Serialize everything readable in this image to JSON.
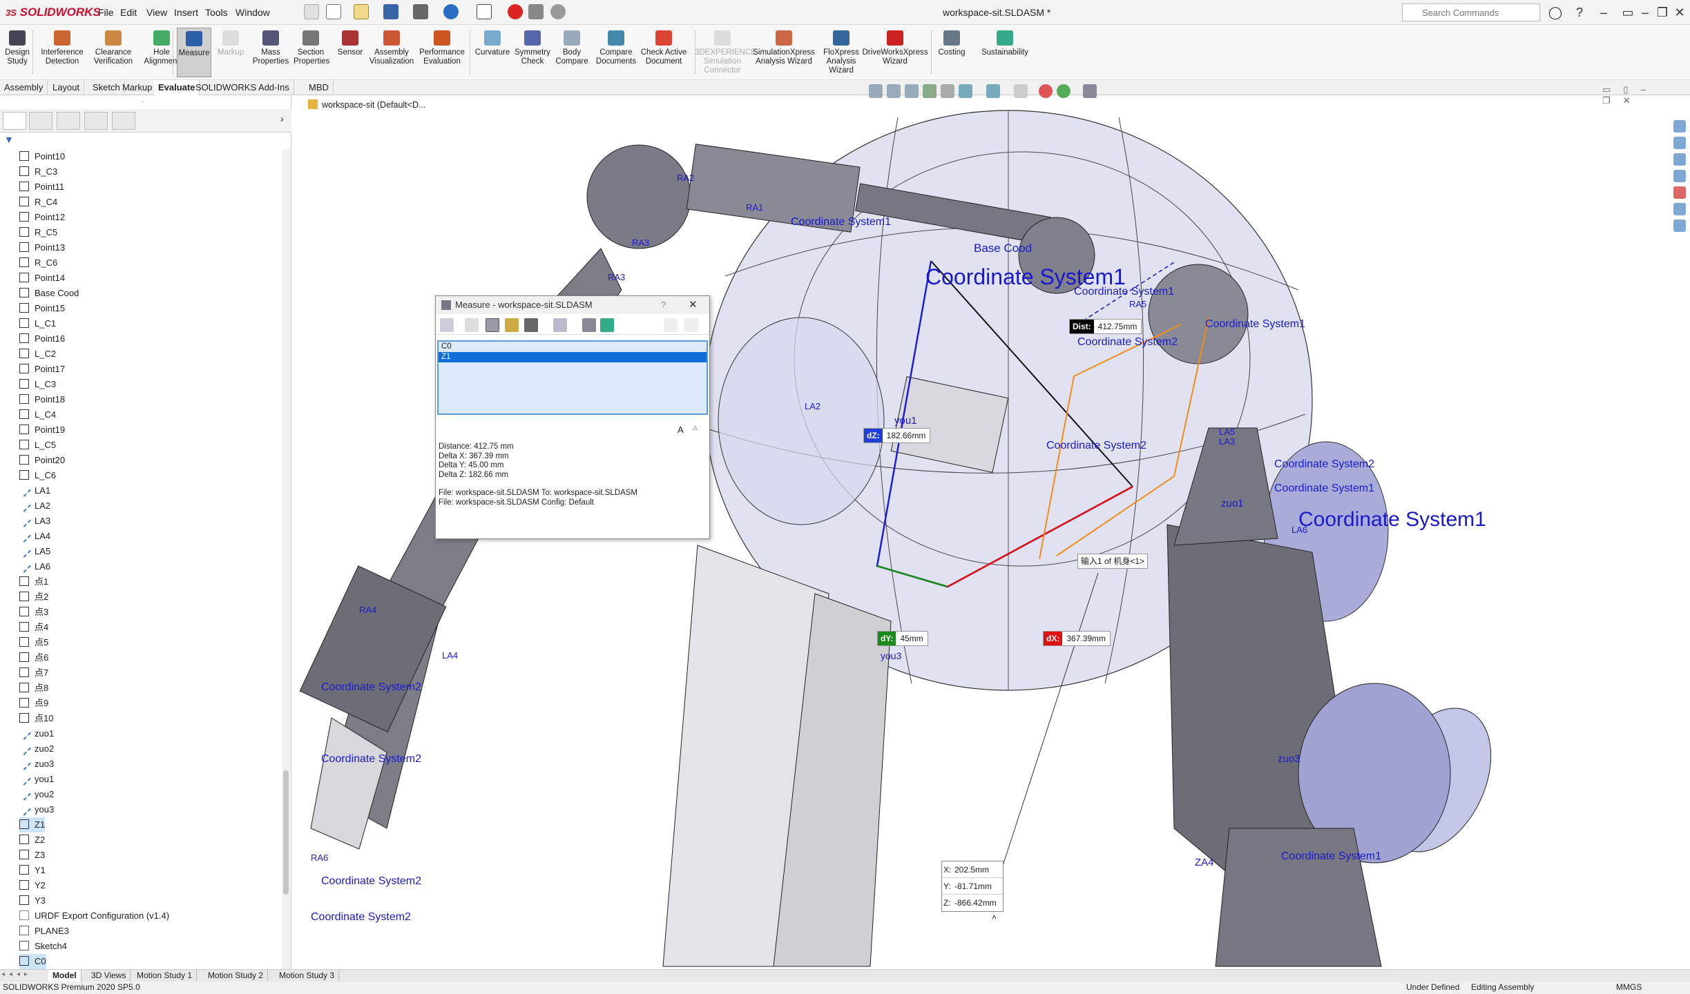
{
  "app": {
    "logo_brand": "SOLIDWORKS",
    "logo_prefix": "3S",
    "doc_title": "workspace-sit.SLDASM *",
    "search_placeholder": "Search Commands"
  },
  "menu": [
    "File",
    "Edit",
    "View",
    "Insert",
    "Tools",
    "Window"
  ],
  "ribbon": [
    {
      "label": "Design\nStudy"
    },
    {
      "label": "Interference\nDetection"
    },
    {
      "label": "Clearance\nVerification"
    },
    {
      "label": "Hole\nAlignment"
    },
    {
      "label": "Measure",
      "active": true
    },
    {
      "label": "Markup",
      "disabled": true
    },
    {
      "label": "Mass\nProperties"
    },
    {
      "label": "Section\nProperties"
    },
    {
      "label": "Sensor"
    },
    {
      "label": "Assembly\nVisualization"
    },
    {
      "label": "Performance\nEvaluation"
    },
    {
      "label": "Curvature"
    },
    {
      "label": "Symmetry\nCheck"
    },
    {
      "label": "Body\nCompare"
    },
    {
      "label": "Compare\nDocuments"
    },
    {
      "label": "Check Active\nDocument"
    },
    {
      "label": "3DEXPERIENCE\nSimulation\nConnector",
      "disabled": true
    },
    {
      "label": "SimulationXpress\nAnalysis Wizard"
    },
    {
      "label": "FloXpress\nAnalysis\nWizard"
    },
    {
      "label": "DriveWorksXpress\nWizard"
    },
    {
      "label": "Costing"
    },
    {
      "label": "Sustainability"
    }
  ],
  "command_tabs": [
    "Assembly",
    "Layout",
    "Sketch",
    "Markup",
    "Evaluate",
    "SOLIDWORKS Add-Ins",
    "MBD"
  ],
  "selected_command_tab": "Evaluate",
  "tree_items": [
    {
      "label": "Point10",
      "kind": "point"
    },
    {
      "label": "R_C3",
      "kind": "cs"
    },
    {
      "label": "Point11",
      "kind": "point"
    },
    {
      "label": "R_C4",
      "kind": "cs"
    },
    {
      "label": "Point12",
      "kind": "point"
    },
    {
      "label": "R_C5",
      "kind": "cs"
    },
    {
      "label": "Point13",
      "kind": "point"
    },
    {
      "label": "R_C6",
      "kind": "cs"
    },
    {
      "label": "Point14",
      "kind": "point"
    },
    {
      "label": "Base Cood",
      "kind": "cs"
    },
    {
      "label": "Point15",
      "kind": "point"
    },
    {
      "label": "L_C1",
      "kind": "cs"
    },
    {
      "label": "Point16",
      "kind": "point"
    },
    {
      "label": "L_C2",
      "kind": "cs"
    },
    {
      "label": "Point17",
      "kind": "point"
    },
    {
      "label": "L_C3",
      "kind": "cs"
    },
    {
      "label": "Point18",
      "kind": "point"
    },
    {
      "label": "L_C4",
      "kind": "cs"
    },
    {
      "label": "Point19",
      "kind": "point"
    },
    {
      "label": "L_C5",
      "kind": "cs"
    },
    {
      "label": "Point20",
      "kind": "point"
    },
    {
      "label": "L_C6",
      "kind": "cs"
    },
    {
      "label": "LA1",
      "kind": "axis"
    },
    {
      "label": "LA2",
      "kind": "axis"
    },
    {
      "label": "LA3",
      "kind": "axis"
    },
    {
      "label": "LA4",
      "kind": "axis"
    },
    {
      "label": "LA5",
      "kind": "axis"
    },
    {
      "label": "LA6",
      "kind": "axis"
    },
    {
      "label": "点1",
      "kind": "point"
    },
    {
      "label": "点2",
      "kind": "point"
    },
    {
      "label": "点3",
      "kind": "point"
    },
    {
      "label": "点4",
      "kind": "point"
    },
    {
      "label": "点5",
      "kind": "point"
    },
    {
      "label": "点6",
      "kind": "point"
    },
    {
      "label": "点7",
      "kind": "point"
    },
    {
      "label": "点8",
      "kind": "point"
    },
    {
      "label": "点9",
      "kind": "point"
    },
    {
      "label": "点10",
      "kind": "point"
    },
    {
      "label": "zuo1",
      "kind": "axis"
    },
    {
      "label": "zuo2",
      "kind": "axis"
    },
    {
      "label": "zuo3",
      "kind": "axis"
    },
    {
      "label": "you1",
      "kind": "axis"
    },
    {
      "label": "you2",
      "kind": "axis"
    },
    {
      "label": "you3",
      "kind": "axis"
    },
    {
      "label": "Z1",
      "kind": "cs",
      "selected": true
    },
    {
      "label": "Z2",
      "kind": "cs"
    },
    {
      "label": "Z3",
      "kind": "cs"
    },
    {
      "label": "Y1",
      "kind": "cs"
    },
    {
      "label": "Y2",
      "kind": "cs"
    },
    {
      "label": "Y3",
      "kind": "cs"
    },
    {
      "label": "URDF Export Configuration (v1.4)",
      "kind": "config"
    },
    {
      "label": "PLANE3",
      "kind": "plane"
    },
    {
      "label": "Sketch4",
      "kind": "sketch"
    },
    {
      "label": "C0",
      "kind": "cs",
      "selected": true
    }
  ],
  "breadcrumb": "workspace-sit  (Default<D...",
  "measure": {
    "title": "Measure - workspace-sit.SLDASM",
    "selections": [
      "C0",
      "Z1"
    ],
    "results": [
      "Distance: 412.75 mm",
      "Delta X: 367.39 mm",
      "Delta Y: 45.00 mm",
      "Delta Z: 182.66 mm",
      "",
      "File: workspace-sit.SLDASM To: workspace-sit.SLDASM",
      "File: workspace-sit.SLDASM Config: Default"
    ]
  },
  "callouts": {
    "dist": {
      "tag": "Dist:",
      "value": "412.75mm"
    },
    "dz": {
      "tag": "dZ:",
      "value": "182.66mm"
    },
    "dy": {
      "tag": "dY:",
      "value": "45mm"
    },
    "dx": {
      "tag": "dX:",
      "value": "367.39mm"
    },
    "tooltip": "输入1 of 机身<1>",
    "coord_x": {
      "tag": "X:",
      "value": "202.5mm"
    },
    "coord_y": {
      "tag": "Y:",
      "value": "-81.71mm"
    },
    "coord_z": {
      "tag": "Z:",
      "value": "-866.42mm"
    }
  },
  "viewport_labels": [
    "Coordinate System1",
    "Coordinate System1",
    "Coordinate System2",
    "Coordinate System1",
    "Coordinate System2",
    "Coordinate System2",
    "Coordinate System1",
    "Coordinate System2",
    "Coordinate System1",
    "Coordinate System1",
    "Coordinate System2",
    "Coordinate System2",
    "Coordinate System1",
    "Coordinate System2",
    "Base Cood",
    "you1",
    "zuo1",
    "zuo3",
    "you3",
    "RA1",
    "RA3",
    "RA4",
    "LA4",
    "RA6",
    "RA2",
    "LA2",
    "RA5",
    "LA5",
    "RA3",
    "LA3",
    "ZA4",
    "LA6"
  ],
  "bottom_tabs": [
    "Model",
    "3D Views",
    "Motion Study 1",
    "Motion Study 2",
    "Motion Study 3"
  ],
  "status": {
    "left": "SOLIDWORKS Premium 2020 SP5.0",
    "under_defined": "Under Defined",
    "editing": "Editing Assembly",
    "units": "MMGS"
  },
  "colors": {
    "accent": "#c8102e",
    "selection": "#0f6fd6",
    "cs_blue": "#1a1acc",
    "mesh_fill": "#c8cbe6",
    "part_gray": "#6c6c78"
  }
}
